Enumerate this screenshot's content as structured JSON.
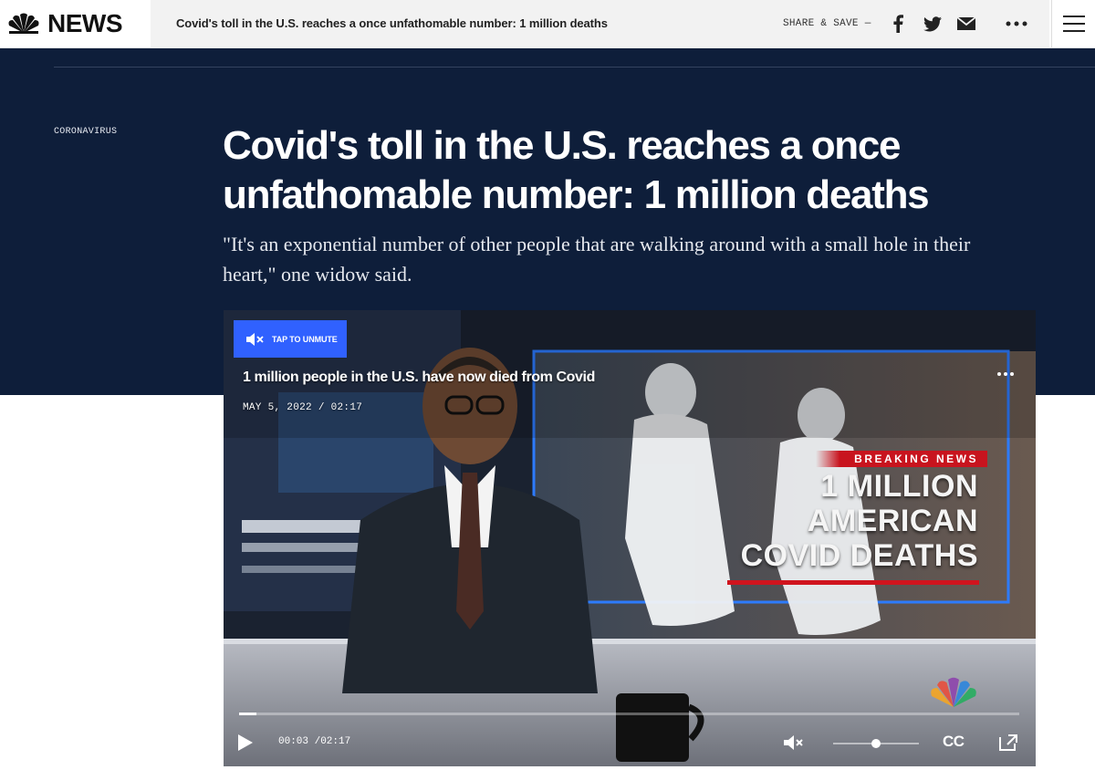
{
  "nav": {
    "brand": "NEWS",
    "title": "Covid's toll in the U.S. reaches a once unfathomable number: 1 million deaths",
    "share_label": "SHARE & SAVE —",
    "icons": [
      "facebook-icon",
      "twitter-icon",
      "email-icon",
      "more-icon",
      "menu-icon"
    ]
  },
  "article": {
    "section": "CORONAVIRUS",
    "headline": "Covid's toll in the U.S. reaches a once unfathomable number: 1 million deaths",
    "dek": "\"It's an exponential number of other people that are walking around with a small hole in their heart,\" one widow said."
  },
  "video": {
    "unmute_label": "TAP TO UNMUTE",
    "title": "1 million people in the U.S. have now died from Covid",
    "meta": "MAY 5, 2022 / 02:17",
    "breaking_tag": "BREAKING NEWS",
    "lower_third": [
      "1 MILLION",
      "AMERICAN",
      "COVID DEATHS"
    ],
    "time_display": "00:03 /02:17",
    "cc_label": "CC",
    "progress": 0.022,
    "volume": 0.5
  },
  "colors": {
    "hero_bg": "#0e1e3a",
    "unmute_bg": "#3061ff",
    "breaking_red": "#c8141e"
  }
}
